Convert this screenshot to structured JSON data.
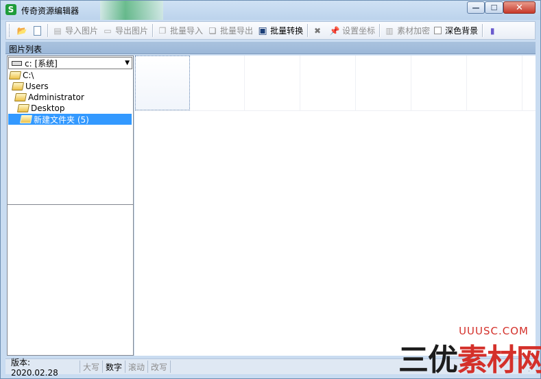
{
  "window": {
    "title": "传奇资源编辑器",
    "app_icon": "green-s-icon",
    "minimize_label": "—",
    "maximize_label": "☐",
    "close_label": "✕"
  },
  "toolbar": {
    "items": [
      {
        "icon": "open-folder-icon",
        "label": ""
      },
      {
        "icon": "new-file-icon",
        "label": ""
      },
      {
        "icon": "import-image-icon",
        "label": "导入图片",
        "disabled": true
      },
      {
        "icon": "export-image-icon",
        "label": "导出图片",
        "disabled": true
      },
      {
        "icon": "batch-import-icon",
        "label": "批量导入",
        "disabled": true
      },
      {
        "icon": "batch-export-icon",
        "label": "批量导出",
        "disabled": true
      },
      {
        "icon": "save-disk-icon",
        "label": "批量转换",
        "disabled": false
      },
      {
        "icon": "delete-x-icon",
        "label": "",
        "disabled": true
      },
      {
        "icon": "pin-icon",
        "label": "设置坐标",
        "disabled": true
      },
      {
        "icon": "encrypt-icon",
        "label": "素材加密",
        "disabled": true
      },
      {
        "icon": "checkbox",
        "label": "深色背景",
        "checked": false
      },
      {
        "icon": "book-icon",
        "label": ""
      }
    ]
  },
  "header": {
    "title": "图片列表"
  },
  "left_panel": {
    "drive_value": "c: [系统]",
    "tree": [
      {
        "label": "C:\\",
        "indent": 0,
        "open": true
      },
      {
        "label": "Users",
        "indent": 1,
        "open": true
      },
      {
        "label": "Administrator",
        "indent": 2,
        "open": true
      },
      {
        "label": "Desktop",
        "indent": 3,
        "open": true
      },
      {
        "label": "新建文件夹 (5)",
        "indent": 4,
        "open": true,
        "selected": true
      }
    ]
  },
  "status": {
    "version": "版本: 2020.02.28",
    "caps": "大写",
    "num": "数字",
    "scroll": "滚动",
    "overwrite": "改写"
  },
  "watermark": {
    "url": "UUUSC.COM",
    "text_black": "三优",
    "text_red": "素材网"
  }
}
